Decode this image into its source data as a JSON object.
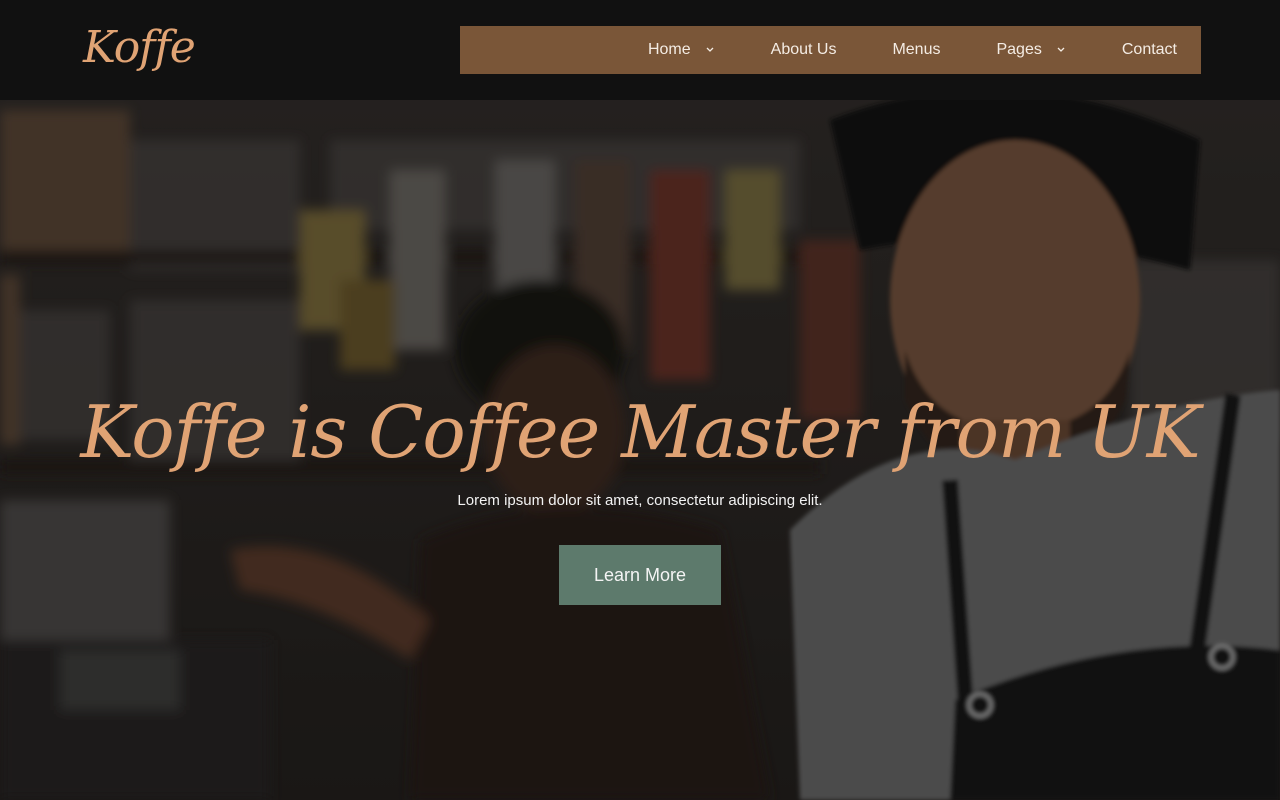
{
  "brand": {
    "logo_text": "Koffe"
  },
  "nav": {
    "items": [
      {
        "label": "Home",
        "has_dropdown": true
      },
      {
        "label": "About Us",
        "has_dropdown": false
      },
      {
        "label": "Menus",
        "has_dropdown": false
      },
      {
        "label": "Pages",
        "has_dropdown": true
      },
      {
        "label": "Contact",
        "has_dropdown": false
      }
    ]
  },
  "hero": {
    "headline": "Koffe is Coffee Master from UK",
    "subtext": "Lorem ipsum dolor sit amet, consectetur adipiscing elit.",
    "cta_label": "Learn More"
  },
  "colors": {
    "accent": "#e0a374",
    "nav_background": "#7a5638",
    "header_background": "#111111",
    "cta_background": "#5d7a6c"
  },
  "icons": {
    "dropdown": "chevron-down-icon"
  }
}
